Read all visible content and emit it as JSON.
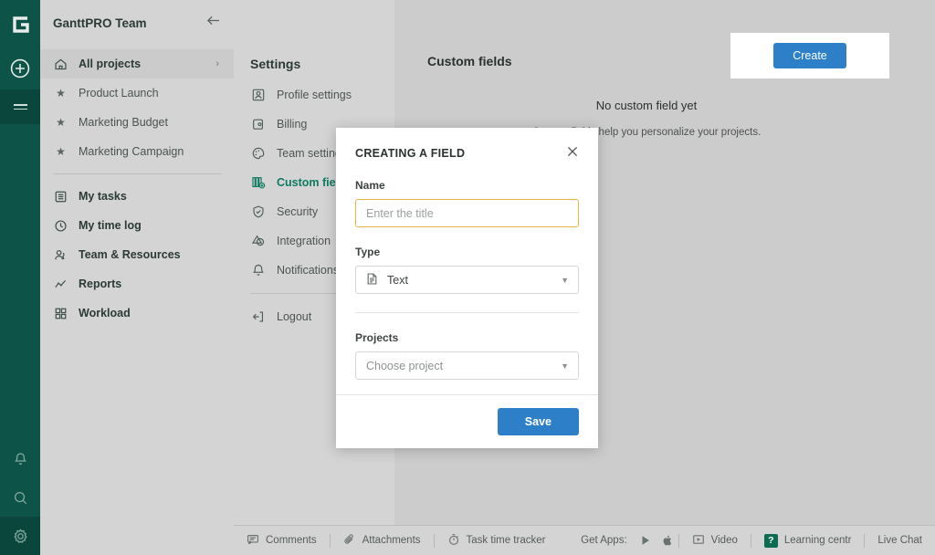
{
  "rail": {
    "logo": "G",
    "buttons": [
      {
        "name": "add-icon",
        "label": "Add"
      },
      {
        "name": "menu-icon",
        "label": "Menu"
      },
      {
        "name": "notifications-icon",
        "label": "Notifications"
      },
      {
        "name": "search-icon",
        "label": "Search"
      },
      {
        "name": "settings-gear-icon",
        "label": "Settings"
      }
    ]
  },
  "sidebar": {
    "title": "GanttPRO Team",
    "collapse_label": "Collapse",
    "items": [
      {
        "label": "All projects",
        "icon": "home-icon",
        "chevron": "›"
      },
      {
        "label": "Product Launch",
        "icon": "star-icon"
      },
      {
        "label": "Marketing Budget",
        "icon": "star-icon"
      },
      {
        "label": "Marketing Campaign",
        "icon": "star-icon"
      },
      {
        "label": "My tasks",
        "icon": "list-icon"
      },
      {
        "label": "My time log",
        "icon": "clock-icon"
      },
      {
        "label": "Team & Resources",
        "icon": "people-icon"
      },
      {
        "label": "Reports",
        "icon": "chart-icon"
      },
      {
        "label": "Workload",
        "icon": "grid-icon"
      }
    ]
  },
  "settings": {
    "title": "Settings",
    "items": [
      {
        "label": "Profile settings",
        "icon": "profile-icon"
      },
      {
        "label": "Billing",
        "icon": "wallet-icon"
      },
      {
        "label": "Team settings",
        "icon": "palette-icon"
      },
      {
        "label": "Custom fields",
        "icon": "custom-fields-icon"
      },
      {
        "label": "Security",
        "icon": "shield-icon"
      },
      {
        "label": "Integration",
        "icon": "integration-icon"
      },
      {
        "label": "Notifications",
        "icon": "bell-icon"
      }
    ],
    "logout": {
      "label": "Logout",
      "icon": "logout-icon"
    },
    "active_index": 3
  },
  "main": {
    "title": "Custom fields",
    "create_label": "Create",
    "empty_title": "No custom field yet",
    "empty_subtitle": "Custom fields help you personalize your projects."
  },
  "modal": {
    "title": "CREATING A FIELD",
    "close_label": "✕",
    "name_label": "Name",
    "name_value": "",
    "name_placeholder": "Enter the title",
    "type_label": "Type",
    "type_value": "Text",
    "type_icon": "document-icon",
    "projects_label": "Projects",
    "projects_value": "Choose project",
    "save_label": "Save"
  },
  "bottombar": {
    "comments": "Comments",
    "attachments": "Attachments",
    "time_tracker": "Task time tracker",
    "get_apps": "Get Apps:",
    "video": "Video",
    "learning": "Learning centr",
    "live_chat": "Live Chat"
  },
  "colors": {
    "brand_green": "#0d5348",
    "accent_teal": "#0d7a62",
    "primary_blue": "#2d80c8",
    "focus_gold": "#e8b54a",
    "panel_gray": "#d4d4d4",
    "page_gray": "#cccccc"
  }
}
